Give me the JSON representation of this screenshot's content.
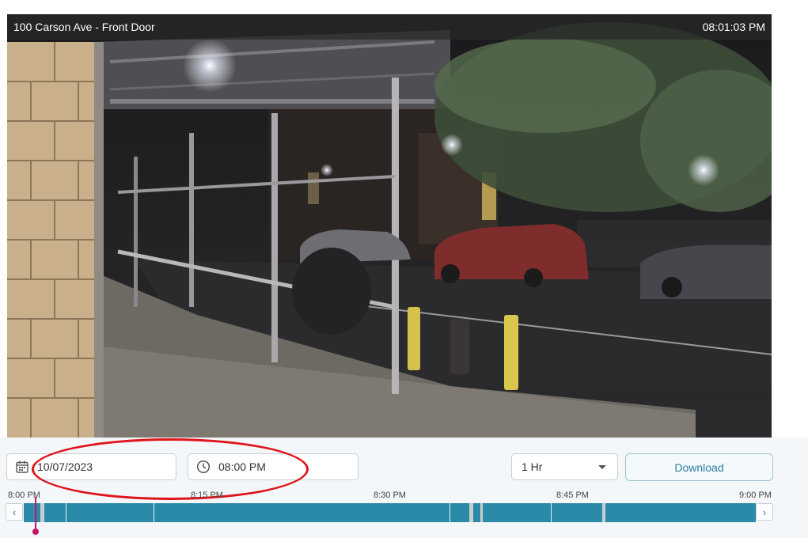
{
  "camera": {
    "title": "100 Carson Ave - Front Door",
    "timestamp": "08:01:03 PM"
  },
  "controls": {
    "date_value": "10/07/2023",
    "time_value": "08:00 PM",
    "range_value": "1 Hr",
    "download_label": "Download"
  },
  "timeline": {
    "ticks": [
      "8:00 PM",
      "8:15 PM",
      "8:30 PM",
      "8:45 PM",
      "9:00 PM"
    ],
    "prev_label": "‹",
    "next_label": "›"
  },
  "colors": {
    "accent": "#2a8aa8",
    "playhead": "#c4146b",
    "annotation": "#e0141c"
  },
  "icons": {
    "date": "calendar-icon",
    "time": "clock-icon",
    "range": "chevron-down-icon"
  }
}
